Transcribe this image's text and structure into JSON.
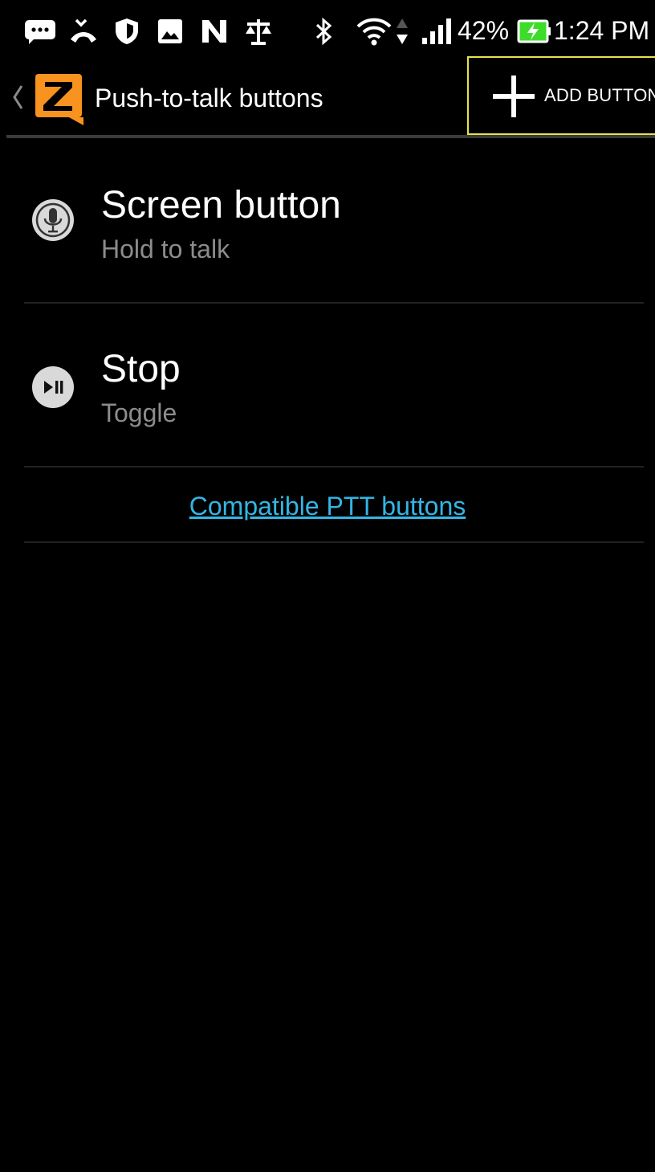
{
  "status_bar": {
    "battery_percent": "42%",
    "time": "1:24 PM",
    "icons": [
      "messages-icon",
      "missed-call-icon",
      "shield-icon",
      "gallery-icon",
      "n-app-icon",
      "scales-icon",
      "bluetooth-icon",
      "wifi-icon",
      "data-arrows-icon",
      "signal-icon",
      "battery-charging-icon"
    ]
  },
  "app_bar": {
    "title": "Push-to-talk buttons",
    "add_label": "ADD BUTTON",
    "logo_letter": "Z"
  },
  "items": [
    {
      "title": "Screen button",
      "subtitle": "Hold to talk",
      "icon": "microphone-icon"
    },
    {
      "title": "Stop",
      "subtitle": "Toggle",
      "icon": "play-pause-icon"
    }
  ],
  "link": {
    "label": "Compatible PTT buttons"
  },
  "colors": {
    "background": "#000000",
    "link": "#33b5e5",
    "logo_orange": "#f7931e",
    "highlight": "#e8e34a",
    "battery_green": "#3ddc2a"
  }
}
